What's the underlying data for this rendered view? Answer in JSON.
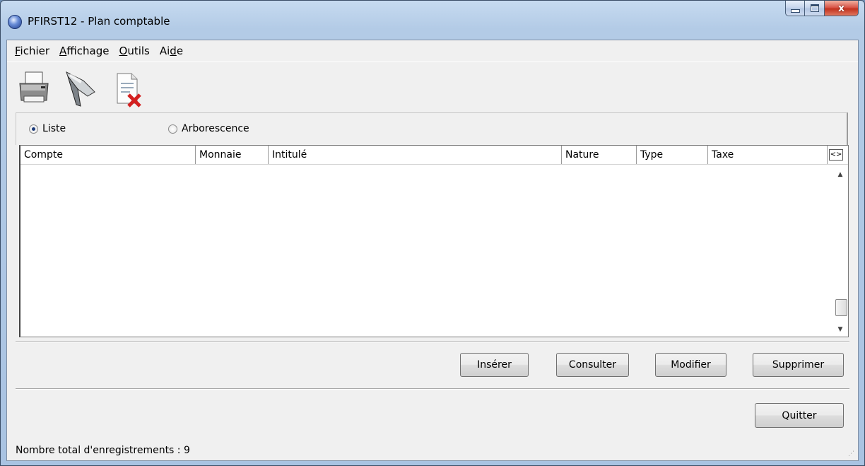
{
  "window": {
    "title": "PFIRST12 - Plan comptable",
    "close_glyph": "x"
  },
  "menu": [
    {
      "mnemonic": "F",
      "rest": "ichier",
      "pre": ""
    },
    {
      "mnemonic": "A",
      "rest": "ffichage",
      "pre": ""
    },
    {
      "mnemonic": "O",
      "rest": "utils",
      "pre": ""
    },
    {
      "mnemonic": "d",
      "rest": "e",
      "pre": "Ai"
    }
  ],
  "toolbar": {
    "icons": [
      "printer-icon",
      "filter-funnel-icon",
      "delete-document-icon"
    ]
  },
  "view": {
    "option_list": "Liste",
    "option_tree": "Arborescence",
    "selected": "Liste"
  },
  "table": {
    "columns": [
      "Compte",
      "Monnaie",
      "Intitulé",
      "Nature",
      "Type",
      "Taxe"
    ],
    "nav_glyph": "<>",
    "rows": []
  },
  "actions": {
    "insert": "Insérer",
    "view": "Consulter",
    "edit": "Modifier",
    "delete": "Supprimer",
    "quit": "Quitter"
  },
  "status": {
    "text": "Nombre total d'enregistrements : 9"
  }
}
